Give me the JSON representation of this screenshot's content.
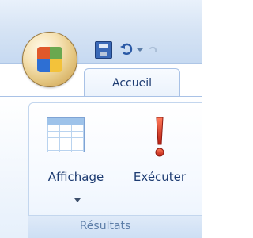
{
  "tabs": {
    "active_label": "Accueil"
  },
  "ribbon": {
    "group_title": "Résultats",
    "buttons": {
      "affichage_label": "Affichage",
      "executer_label": "Exécuter"
    }
  },
  "icons": {
    "office_button": "office-logo-icon",
    "save": "save-icon",
    "undo": "undo-icon",
    "redo": "redo-icon",
    "affichage": "table-view-icon",
    "executer": "exclamation-icon"
  },
  "colors": {
    "accent_text": "#1e3c72",
    "group_title": "#5d7ea8",
    "exclamation": "#d8321f"
  }
}
